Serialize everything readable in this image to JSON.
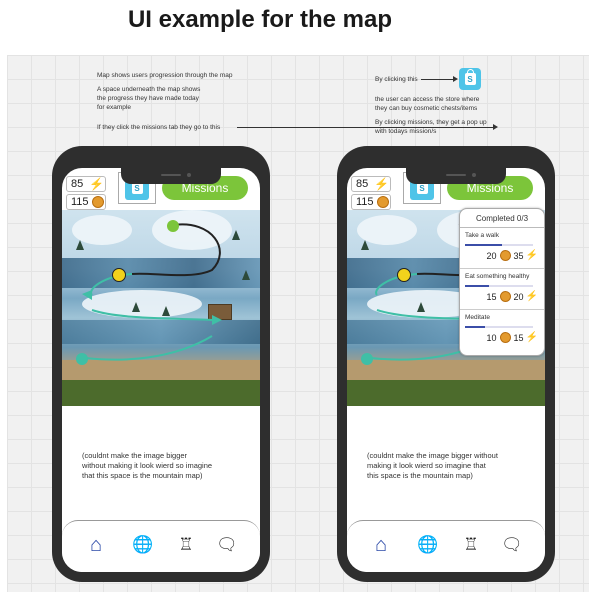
{
  "page": {
    "title": "UI example for the map"
  },
  "notes": {
    "left_top": "Map shows users progression through the map",
    "left_mid": "A space underneath the map shows\nthe progress they have made today\nfor example",
    "left_missions": "If they click the missions tab they go to this",
    "right_store": "By clicking this",
    "right_store_desc": "the user can access the store where\nthey can buy cosmetic chests/items",
    "right_missions": "By clicking missions, they get a pop up\nwith todays mission/s"
  },
  "phones": [
    {
      "energy": "85",
      "coins": "115",
      "missions_label": "Missions",
      "caption": "(couldnt make the image  bigger\nwithout making it look wierd so imagine\nthat this space is the mountain map)"
    },
    {
      "energy": "85",
      "coins": "115",
      "missions_label": "Missions",
      "caption": "(couldnt make the image bigger without\nmaking it look wierd so imagine that\nthis space is the mountain map)",
      "popup": {
        "header": "Completed 0/3",
        "missions": [
          {
            "name": "Take a walk",
            "coins": "20",
            "energy": "35",
            "progress": 0.55
          },
          {
            "name": "Eat something healthy",
            "coins": "15",
            "energy": "20",
            "progress": 0.35
          },
          {
            "name": "Meditate",
            "coins": "10",
            "energy": "15",
            "progress": 0.3
          }
        ]
      }
    }
  ],
  "nav": {
    "items": [
      "home-icon",
      "globe-icon",
      "profile-icon",
      "chat-icon"
    ]
  },
  "colors": {
    "missions_green": "#7cc53a",
    "store_blue": "#4fc4e8",
    "nav_active": "#2c4aa8",
    "phone_body": "#2e2e2e"
  }
}
